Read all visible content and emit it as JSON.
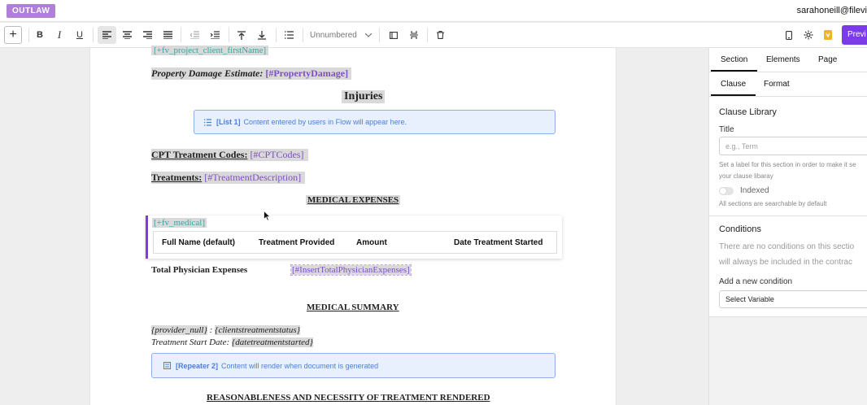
{
  "app": {
    "logo": "OUTLAW",
    "user_email": "sarahoneill@filevi"
  },
  "toolbar": {
    "add_label": "+",
    "bold": "B",
    "italic": "I",
    "underline": "U",
    "numbering": "Unnumbered",
    "preview_label": "Previ"
  },
  "document": {
    "client_firstname_var": "[+fv_project_client_firstName]",
    "property_damage_label": "Property Damage Estimate:",
    "property_damage_var": "[#PropertyDamage]",
    "injuries_heading": "Injuries",
    "list_block": {
      "tag": "[List 1]",
      "text": "Content entered by users in Flow will appear here."
    },
    "cpt_label": "CPT Treatment Codes:",
    "cpt_var": "[#CPTCodes]",
    "treatments_label": "Treatments:",
    "treatments_var": "[#TreatmentDescription]",
    "medical_expenses_heading": "MEDICAL EXPENSES",
    "medical_var": "[+fv_medical]",
    "table_columns": [
      "Full Name (default)",
      "Treatment Provided",
      "Amount",
      "Date Treatment Started"
    ],
    "total_physician_label": "Total Physician Expenses",
    "total_physician_var": "[#InsertTotalPhysicianExpenses]",
    "medical_summary_heading": "MEDICAL SUMMARY",
    "provider_var": "{provider_null}",
    "provider_sep": " : ",
    "status_var": "{clientstreatmentstatus}",
    "start_date_label": "Treatment Start Date:",
    "start_date_var": "{datetreatmentstarted}",
    "repeater_block": {
      "tag": "[Repeater 2]",
      "text": "Content will render when document is generated"
    },
    "reasonableness_heading": "REASONABLENESS AND NECESSITY OF TREATMENT RENDERED"
  },
  "panel": {
    "tabs": [
      "Section",
      "Elements",
      "Page"
    ],
    "subtabs": [
      "Clause",
      "Format"
    ],
    "clause_library_title": "Clause Library",
    "title_label": "Title",
    "title_placeholder": "e.g., Term",
    "title_hint_1": "Set a label for this section in order to make it se",
    "title_hint_2": "your clause libaray",
    "indexed_label": "Indexed",
    "indexed_hint": "All sections are searchable by default",
    "conditions_title": "Conditions",
    "conditions_text_1": "There are no conditions on this sectio",
    "conditions_text_2": "will always be included in the contrac",
    "add_condition_label": "Add a new condition",
    "select_variable": "Select Variable"
  }
}
